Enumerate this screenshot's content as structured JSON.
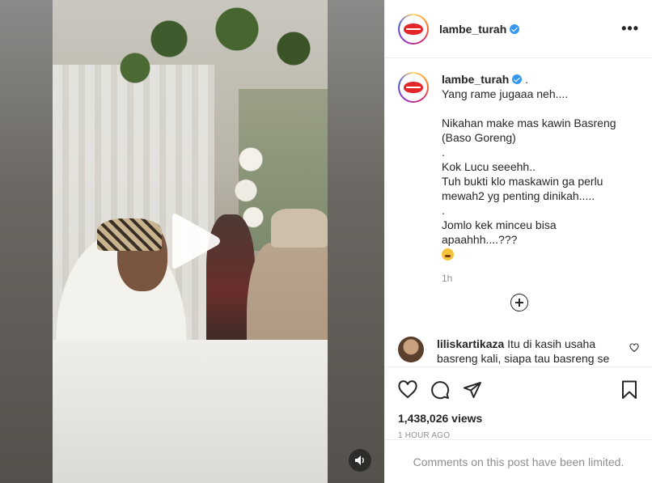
{
  "post": {
    "username": "lambe_turah",
    "caption_suffix": ".",
    "caption_lines": [
      "Yang rame jugaaa neh....",
      "",
      "Nikahan make mas kawin Basreng",
      "(Baso Goreng)",
      ".",
      "Kok Lucu seeehh..",
      "Tuh bukti klo maskawin ga perlu",
      "mewah2 yg penting dinikah.....",
      ".",
      "Jomlo kek minceu bisa apaahhh....???"
    ],
    "caption_time": "1h",
    "views": "1,438,026 views",
    "posted_ago": "1 HOUR AGO",
    "comments_limited": "Comments on this post have been limited."
  },
  "comment": {
    "username": "liliskartikaza",
    "text": "Itu di kasih usaha basreng kali, siapa tau basreng se"
  },
  "icons": {
    "play": "play-icon",
    "mute": "speaker-icon",
    "more": "more-options-icon",
    "like": "heart-icon",
    "comment": "comment-icon",
    "share": "paper-plane-icon",
    "save": "bookmark-icon",
    "verified": "verified-badge-icon",
    "emoji": "tired-face-emoji"
  },
  "colors": {
    "verified": "#3897f0",
    "brand_lips": "#e3262a",
    "muted_text": "#8e8e8e"
  }
}
